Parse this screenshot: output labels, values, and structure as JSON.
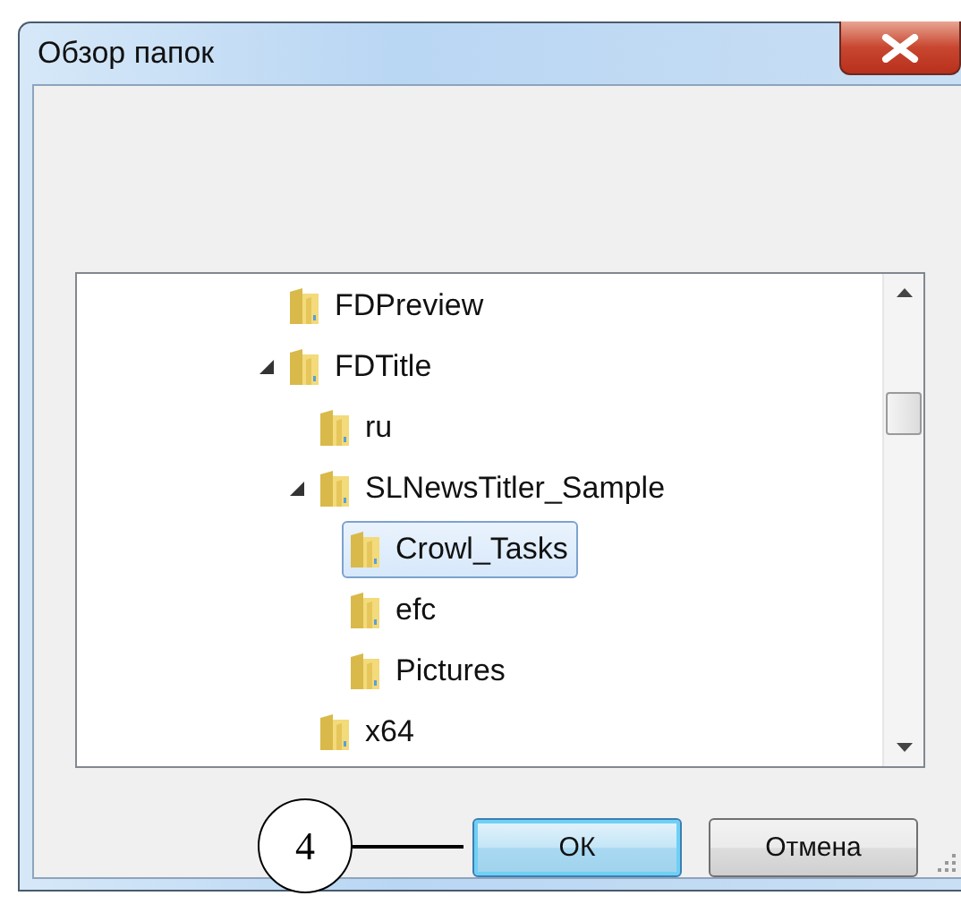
{
  "window": {
    "title": "Обзор папок"
  },
  "tree": {
    "items": [
      {
        "name": "FDPreview",
        "expanded": false,
        "selected": false
      },
      {
        "name": "FDTitle",
        "expanded": true,
        "selected": false,
        "children": [
          {
            "name": "ru",
            "expanded": false,
            "selected": false
          },
          {
            "name": "SLNewsTitler_Sample",
            "expanded": true,
            "selected": false,
            "children": [
              {
                "name": "Crowl_Tasks",
                "expanded": false,
                "selected": true
              },
              {
                "name": "efc",
                "expanded": false,
                "selected": false
              },
              {
                "name": "Pictures",
                "expanded": false,
                "selected": false
              }
            ]
          },
          {
            "name": "x64",
            "expanded": false,
            "selected": false
          }
        ]
      }
    ]
  },
  "buttons": [
    {
      "label": "ОК",
      "default": true
    },
    {
      "label": "Отмена",
      "default": false
    }
  ],
  "callout": {
    "number": "4"
  }
}
